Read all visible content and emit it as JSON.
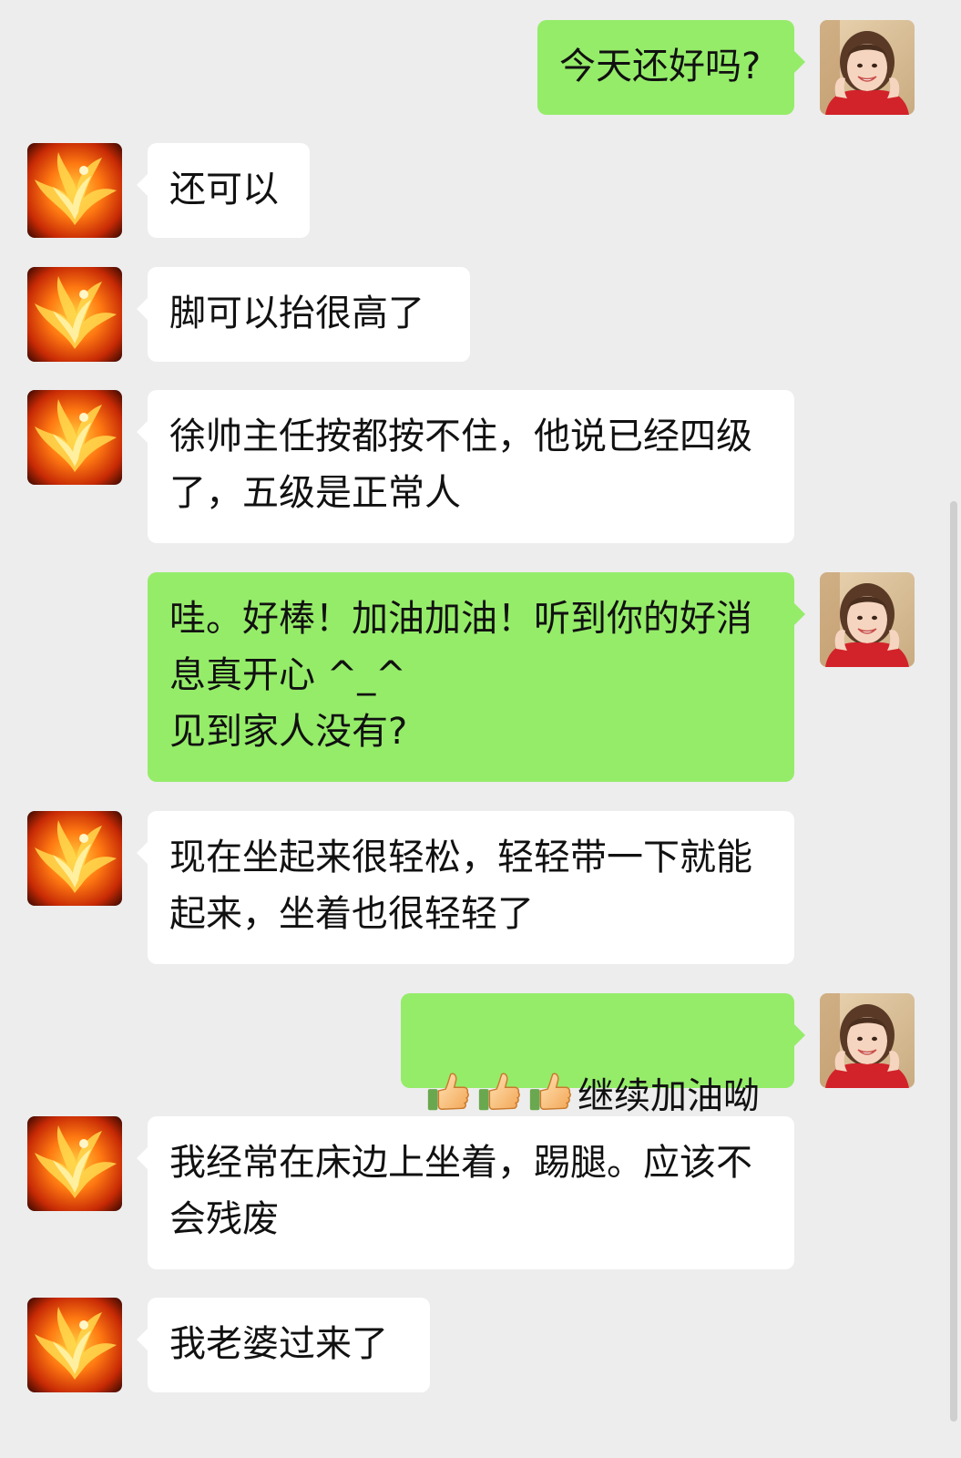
{
  "messages": [
    {
      "side": "out",
      "text": "今天还好吗?"
    },
    {
      "side": "in",
      "text": "还可以"
    },
    {
      "side": "in",
      "text": "脚可以抬很高了"
    },
    {
      "side": "in",
      "text": "徐帅主任按都按不住，他说已经四级了，五级是正常人"
    },
    {
      "side": "out",
      "text": "哇。好棒！加油加油！听到你的好消息真开心 ^_^\n见到家人没有?"
    },
    {
      "side": "in",
      "text": "现在坐起来很轻松，轻轻带一下就能起来，坐着也很轻轻了"
    },
    {
      "side": "out",
      "emoji": [
        "thumbs-up",
        "thumbs-up",
        "thumbs-up"
      ],
      "text": "继续加油呦"
    },
    {
      "side": "in",
      "text": "我经常在床边上坐着，踢腿。应该不会残废"
    },
    {
      "side": "in",
      "text": "我老婆过来了"
    }
  ],
  "avatars": {
    "in": "phoenix-avatar",
    "out": "woman-avatar"
  },
  "colors": {
    "background": "#ededed",
    "incoming_bubble": "#ffffff",
    "outgoing_bubble": "#95ec69"
  }
}
